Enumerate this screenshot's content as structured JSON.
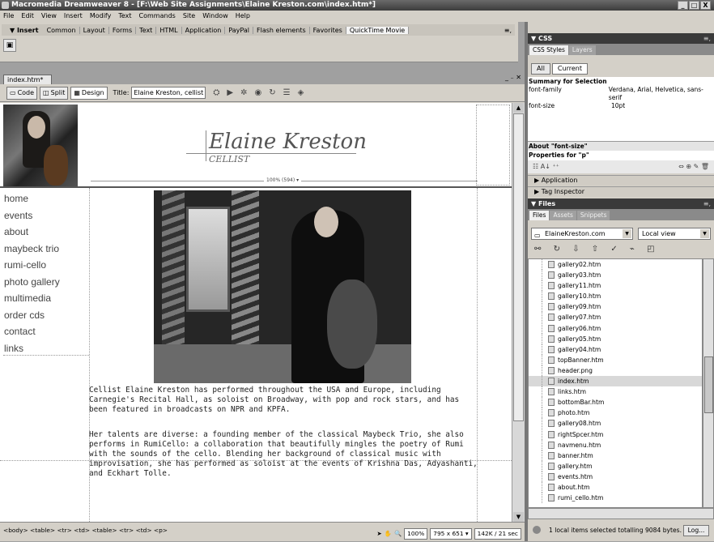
{
  "window": {
    "title": "Macromedia Dreamweaver 8 - [F:\\Web Site Assignments\\Elaine Kreston.com\\index.htm*]",
    "controls": [
      "_",
      "□",
      "X"
    ]
  },
  "menubar": {
    "items": [
      "File",
      "Edit",
      "View",
      "Insert",
      "Modify",
      "Text",
      "Commands",
      "Site",
      "Window",
      "Help"
    ]
  },
  "insert_bar": {
    "label": "▼ Insert",
    "tabs": [
      "Common",
      "Layout",
      "Forms",
      "Text",
      "HTML",
      "Application",
      "PayPal",
      "Flash elements",
      "Favorites",
      "QuickTime Movie"
    ],
    "active_tab": "QuickTime Movie",
    "menu_icon": "≡,"
  },
  "document": {
    "tab_label": "index.htm*",
    "window_controls": "_ ₋ ✕",
    "view_buttons": [
      "Code",
      "Split",
      "Design"
    ],
    "active_view": "Design",
    "title_label": "Title:",
    "title_value": "Elaine Kreston, cellist",
    "icons": [
      "validate-icon",
      "preview-icon",
      "debug-icon",
      "globe-icon",
      "refresh-icon",
      "view-options-icon",
      "visual-aids-icon"
    ]
  },
  "page": {
    "banner_name": "Elaine Kreston",
    "banner_sub": "CELLIST",
    "width_indicator": "100% (594) ▾",
    "nav": [
      "home",
      "events",
      "about",
      "maybeck trio",
      "rumi-cello",
      "photo gallery",
      "multimedia",
      "order cds",
      "contact",
      "links"
    ],
    "para1": "Cellist Elaine Kreston has performed throughout the USA and Europe, including Carnegie's Recital Hall, as soloist on Broadway, with pop and rock stars, and has been featured in broadcasts on NPR and KPFA.",
    "para2": "Her talents are diverse: a founding member of the classical Maybeck Trio, she also performs in RumiCello: a collaboration that beautifully mingles the poetry of Rumi with the sounds of the cello. Blending her background of classical music with improvisation, she has performed as soloist at the events of Krishna Das, Adyashanti, and Eckhart Tolle."
  },
  "statusbar": {
    "tag_selector": "<body> <table> <tr> <td> <table> <tr> <td> <p>",
    "zoom": "100%",
    "size": "795 x 651 ▾",
    "download": "142K / 21 sec"
  },
  "css_panel": {
    "header": "▼ CSS",
    "tabs": [
      "CSS Styles",
      "Layers"
    ],
    "active_tab": "CSS Styles",
    "mode_buttons": [
      "All",
      "Current"
    ],
    "active_mode": "Current",
    "summary_title": "Summary for Selection",
    "properties": [
      {
        "name": "font-family",
        "value": "Verdana, Arial, Helvetica, sans-serif"
      },
      {
        "name": "font-size",
        "value": "10pt"
      }
    ],
    "about_label": "About \"font-size\"",
    "properties_for": "Properties for \"p\""
  },
  "collapsed_panels": [
    "▶ Application",
    "▶ Tag Inspector"
  ],
  "files_panel": {
    "header": "▼ Files",
    "tabs": [
      "Files",
      "Assets",
      "Snippets"
    ],
    "active_tab": "Files",
    "site": "ElaineKreston.com",
    "view": "Local view",
    "files": [
      "gallery02.htm",
      "gallery03.htm",
      "gallery11.htm",
      "gallery10.htm",
      "gallery09.htm",
      "gallery07.htm",
      "gallery06.htm",
      "gallery05.htm",
      "gallery04.htm",
      "topBanner.htm",
      "header.png",
      "index.htm",
      "links.htm",
      "bottomBar.htm",
      "photo.htm",
      "gallery08.htm",
      "rightSpcer.htm",
      "navmenu.htm",
      "banner.htm",
      "gallery.htm",
      "events.htm",
      "about.htm",
      "rumi_cello.htm"
    ],
    "selected_file": "index.htm",
    "status": "1 local items selected totalling 9084 bytes.",
    "log_button": "Log..."
  }
}
